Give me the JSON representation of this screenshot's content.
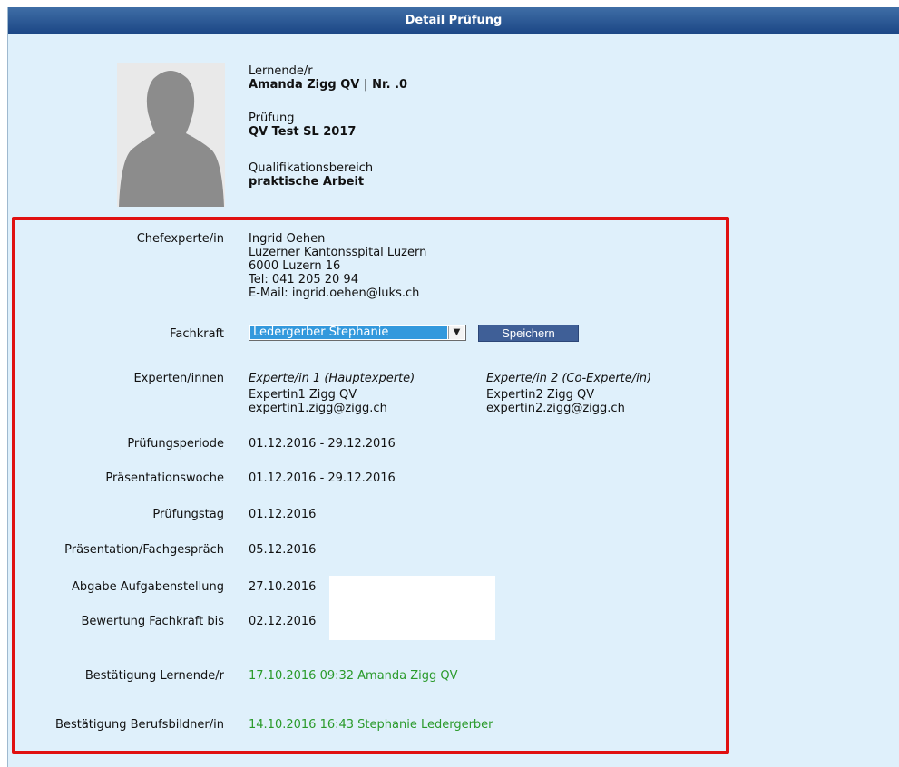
{
  "header": {
    "title": "Detail Prüfung"
  },
  "student": {
    "learner_label": "Lernende/r",
    "learner_value": "Amanda Zigg QV | Nr. .0",
    "exam_label": "Prüfung",
    "exam_value": "QV Test SL 2017",
    "area_label": "Qualifikationsbereich",
    "area_value": "praktische Arbeit"
  },
  "chief_expert": {
    "label": "Chefexperte/in",
    "name": "Ingrid Oehen",
    "org": "Luzerner Kantonsspital Luzern",
    "city": "6000 Luzern 16",
    "tel": "Tel: 041 205 20 94",
    "email": "E-Mail: ingrid.oehen@luks.ch"
  },
  "fachkraft": {
    "label": "Fachkraft",
    "selected": "Ledergerber Stephanie",
    "save_label": "Speichern"
  },
  "experts": {
    "label": "Experten/innen",
    "expert1": {
      "role": "Experte/in 1 (Hauptexperte)",
      "name": "Expertin1 Zigg QV",
      "email": "expertin1.zigg@zigg.ch"
    },
    "expert2": {
      "role": "Experte/in 2 (Co-Experte/in)",
      "name": "Expertin2 Zigg QV",
      "email": "expertin2.zigg@zigg.ch"
    }
  },
  "dates": {
    "pruefungsperiode_label": "Prüfungsperiode",
    "pruefungsperiode_value": "01.12.2016 - 29.12.2016",
    "praesentationswoche_label": "Präsentationswoche",
    "praesentationswoche_value": "01.12.2016 - 29.12.2016",
    "pruefungstag_label": "Prüfungstag",
    "pruefungstag_value": "01.12.2016",
    "fachgespraech_label": "Präsentation/Fachgespräch",
    "fachgespraech_value": "05.12.2016",
    "abgabe_label": "Abgabe Aufgabenstellung",
    "abgabe_value": "27.10.2016",
    "bewertung_label": "Bewertung Fachkraft bis",
    "bewertung_value": "02.12.2016"
  },
  "confirmations": {
    "learner_label": "Bestätigung Lernende/r",
    "learner_value": "17.10.2016 09:32  Amanda Zigg QV",
    "trainer_label": "Bestätigung Berufsbildner/in",
    "trainer_value": "14.10.2016 16:43  Stephanie Ledergerber"
  },
  "colors": {
    "header_bg": "#1c4786",
    "panel_bg": "#dff0fb",
    "highlight_border": "#e01010",
    "confirmation_text": "#2a9a2a",
    "select_highlight": "#3399dd",
    "save_button_bg": "#3f5f97"
  },
  "icons": {
    "photo": "person-silhouette-icon",
    "dropdown": "chevron-down-icon"
  }
}
